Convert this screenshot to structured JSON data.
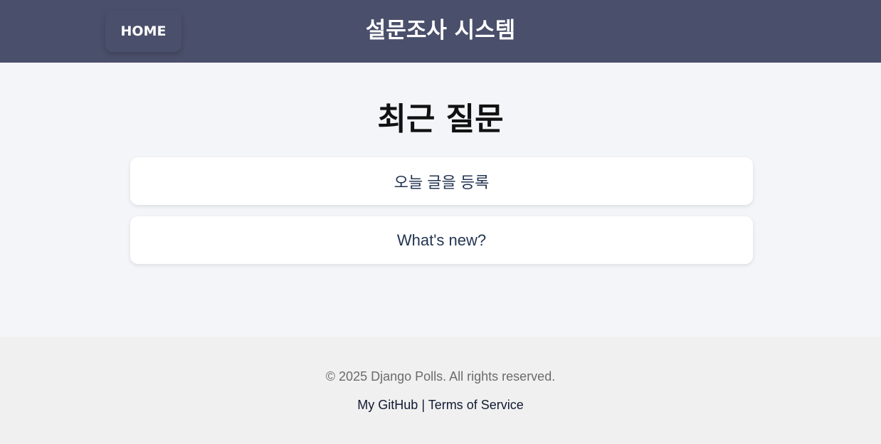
{
  "header": {
    "home_label": "HOME",
    "title": "설문조사 시스템"
  },
  "main": {
    "section_title": "최근 질문",
    "questions": [
      {
        "label": "오늘 글을 등록"
      },
      {
        "label": "What's new?"
      }
    ]
  },
  "footer": {
    "copyright": "© 2025 Django Polls. All rights reserved.",
    "links": [
      {
        "label": "My GitHub"
      },
      {
        "label": "Terms of Service"
      }
    ],
    "separator": "|"
  },
  "colors": {
    "header_bg": "#4a4f6b",
    "page_bg": "#f4f5f9",
    "footer_bg": "#f0f0f0",
    "question_text": "#233552"
  }
}
